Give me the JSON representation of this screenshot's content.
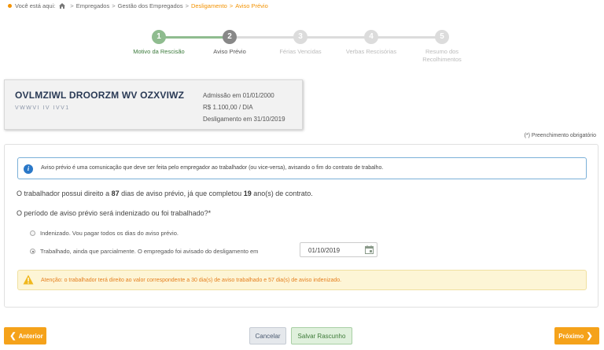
{
  "breadcrumb": {
    "prefix": "Você está aqui:",
    "items": [
      "Empregados",
      "Gestão dos Empregados",
      "Desligamento",
      "Aviso Prévio"
    ]
  },
  "stepper": {
    "steps": [
      {
        "number": "1",
        "label": "Motivo da Rescisão",
        "state": "done"
      },
      {
        "number": "2",
        "label": "Aviso Prévio",
        "state": "current"
      },
      {
        "number": "3",
        "label": "Férias Vencidas",
        "state": "todo"
      },
      {
        "number": "4",
        "label": "Verbas Rescisórias",
        "state": "todo"
      },
      {
        "number": "5",
        "label": "Resumo dos Recolhimentos",
        "state": "todo"
      }
    ]
  },
  "employee": {
    "name": "OVLMZIWL DROORZM WV OZXVIWZ",
    "id": "VWWVI IV IVV1",
    "admission": "Admissão em 01/01/2000",
    "salary": "R$ 1.100,00 / DIA",
    "termination": "Desligamento em 31/10/2019"
  },
  "required_note": "(*) Preenchimento obrigatório",
  "info": {
    "text": "Aviso prévio é uma comunicação que deve ser feita pelo empregador ao trabalhador (ou vice-versa), avisando o fim do contrato de trabalho."
  },
  "entitlement": {
    "part1": "O trabalhador possui direito a ",
    "days": "87",
    "part2": " dias de aviso prévio, já que completou ",
    "years": "19",
    "part3": " ano(s) de contrato."
  },
  "question": "O período de aviso prévio será indenizado ou foi trabalhado?*",
  "options": {
    "indemnified": {
      "label": "Indenizado. Vou pagar todos os dias do aviso prévio.",
      "checked": false
    },
    "worked": {
      "label": "Trabalhado, ainda que parcialmente. O empregado foi avisado do desligamento em",
      "checked": true
    }
  },
  "notice_date": "01/10/2019",
  "warning": {
    "text": "Atenção: o trabalhador terá direito ao valor correspondente a 30 dia(s) de aviso trabalhado e 57 dia(s) de aviso indenizado."
  },
  "buttons": {
    "previous": "Anterior",
    "cancel": "Cancelar",
    "save_draft": "Salvar Rascunho",
    "next": "Próximo"
  },
  "colors": {
    "accent_orange": "#f5a21a",
    "step_done": "#8fbc8f",
    "info_blue": "#2a78c8"
  }
}
